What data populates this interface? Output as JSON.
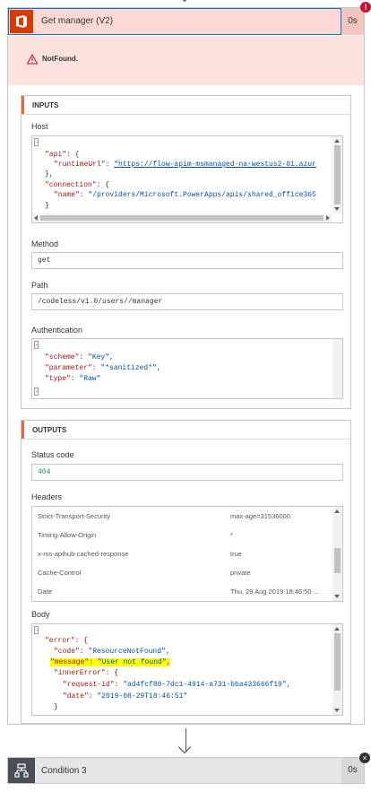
{
  "action": {
    "title": "Get manager (V2)",
    "duration": "0s",
    "error_badge": "!",
    "error_text": "NotFound."
  },
  "inputs": {
    "heading": "INPUTS",
    "host": {
      "label": "Host",
      "lines": [
        "\"api\": {",
        "\"runtimeUrl\": ",
        "\"https://flow-apim-msmanaged-na-westus2-01.azur",
        "},",
        "\"connection\": {",
        "\"name\": ",
        "\"/providers/Microsoft.PowerApps/apis/shared_office365",
        "}"
      ]
    },
    "method": {
      "label": "Method",
      "value": "get"
    },
    "path": {
      "label": "Path",
      "value": "/codeless/v1.0/users//manager"
    },
    "authentication": {
      "label": "Authentication",
      "scheme_key": "\"scheme\": ",
      "scheme_val": "\"Key\",",
      "parameter_key": "\"parameter\": ",
      "parameter_val": "\"*sanitized*\",",
      "type_key": "\"type\": ",
      "type_val": "\"Raw\""
    }
  },
  "outputs": {
    "heading": "OUTPUTS",
    "status": {
      "label": "Status code",
      "value": "404"
    },
    "headers": {
      "label": "Headers",
      "rows": [
        {
          "name": "Strict-Transport-Security",
          "value": "max-age=31536000"
        },
        {
          "name": "Timing-Allow-Origin",
          "value": "*"
        },
        {
          "name": "x-ms-apihub-cached-response",
          "value": "true"
        },
        {
          "name": "Cache-Control",
          "value": "private"
        },
        {
          "name": "Date",
          "value": "Thu, 29 Aug 2019 18:46:50 ..."
        }
      ]
    },
    "body": {
      "label": "Body",
      "error_key": "\"error\": {",
      "code_key": "\"code\": ",
      "code_val": "\"ResourceNotFound\",",
      "message_key": "\"message\": ",
      "message_val": "\"User not found\",",
      "inner_key": "\"innerError\": {",
      "request_key": "\"request-id\": ",
      "request_val": "\"ad4fcf80-7dc1-4914-a731-bba433666f19\",",
      "date_key": "\"date\": ",
      "date_val": "\"2019-08-29T18:46:51\"",
      "close": "}"
    }
  },
  "condition": {
    "title": "Condition 3",
    "duration": "0s",
    "close_badge": "×"
  },
  "colors": {
    "error_header": "#fcd9d4",
    "office_red": "#d83b01",
    "accent": "#e8694a",
    "json_key": "#a31515",
    "json_string": "#0451a5",
    "status_value": "#2e8b57",
    "highlight": "#ffff00"
  }
}
